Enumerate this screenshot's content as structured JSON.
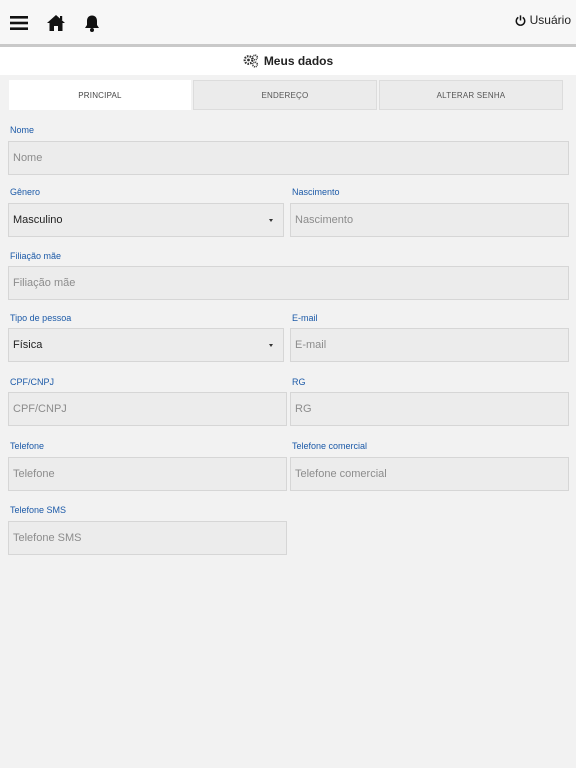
{
  "header": {
    "menu_icon": "hamburger-menu-icon",
    "home_icon": "home-icon",
    "bell_icon": "bell-icon",
    "user_label": "Usuário",
    "user_icon": "power-icon"
  },
  "page": {
    "title": "Meus dados",
    "title_icon": "gears-icon"
  },
  "tabs": [
    {
      "label": "PRINCIPAL",
      "active": true
    },
    {
      "label": "ENDEREÇO",
      "active": false
    },
    {
      "label": "ALTERAR SENHA",
      "active": false
    }
  ],
  "form": {
    "nome": {
      "label": "Nome",
      "placeholder": "Nome",
      "value": ""
    },
    "genero": {
      "label": "Gênero",
      "value": "Masculino"
    },
    "nascimento": {
      "label": "Nascimento",
      "placeholder": "Nascimento",
      "value": ""
    },
    "filiacao_mae": {
      "label": "Filiação mãe",
      "placeholder": "Filiação mãe",
      "value": ""
    },
    "tipo_pessoa": {
      "label": "Tipo de pessoa",
      "value": "Física"
    },
    "email": {
      "label": "E-mail",
      "placeholder": "E-mail",
      "value": ""
    },
    "cpf_cnpj": {
      "label": "CPF/CNPJ",
      "placeholder": "CPF/CNPJ",
      "value": ""
    },
    "rg": {
      "label": "RG",
      "placeholder": "RG",
      "value": ""
    },
    "telefone": {
      "label": "Telefone",
      "placeholder": "Telefone",
      "value": ""
    },
    "telefone_comercial": {
      "label": "Telefone comercial",
      "placeholder": "Telefone comercial",
      "value": ""
    },
    "telefone_sms": {
      "label": "Telefone SMS",
      "placeholder": "Telefone SMS",
      "value": ""
    }
  },
  "colors": {
    "label_blue": "#1c5aa8",
    "background": "#f2f2f2"
  }
}
